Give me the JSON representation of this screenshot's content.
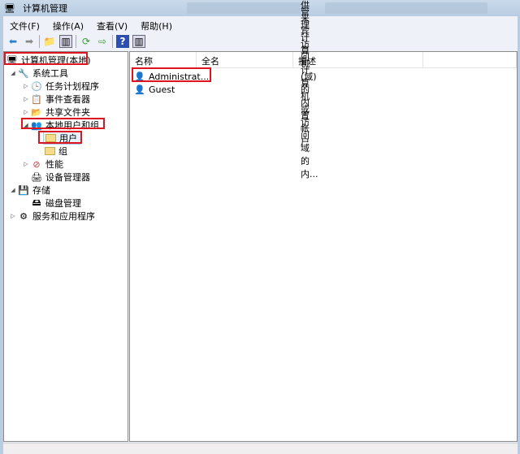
{
  "window": {
    "title": "计算机管理"
  },
  "menu": [
    "文件(F)",
    "操作(A)",
    "查看(V)",
    "帮助(H)"
  ],
  "tree": {
    "root": "计算机管理(本地)",
    "system_tools": "系统工具",
    "task_scheduler": "任务计划程序",
    "event_viewer": "事件查看器",
    "shared_folders": "共享文件夹",
    "local_users": "本地用户和组",
    "users": "用户",
    "groups": "组",
    "performance": "性能",
    "device_manager": "设备管理器",
    "storage": "存储",
    "disk_management": "磁盘管理",
    "services": "服务和应用程序"
  },
  "list": {
    "columns": [
      "名称",
      "全名",
      "描述"
    ],
    "rows": [
      {
        "name": "Administrat...",
        "fullname": "",
        "description": "管理计算机(域)的内置帐户"
      },
      {
        "name": "Guest",
        "fullname": "",
        "description": "供来宾访问计算机或访问域的内..."
      }
    ]
  }
}
